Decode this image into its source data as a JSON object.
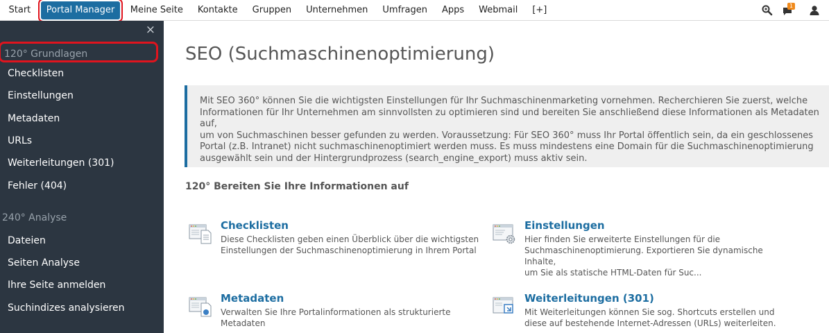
{
  "nav": {
    "items": [
      "Start",
      "Portal Manager",
      "Meine Seite",
      "Kontakte",
      "Gruppen",
      "Unternehmen",
      "Umfragen",
      "Apps",
      "Webmail",
      "[+]"
    ],
    "active_index": 1,
    "notification_count": "1"
  },
  "sidebar": {
    "close": "×",
    "groups": [
      {
        "title": "120° Grundlagen",
        "items": [
          "Checklisten",
          "Einstellungen",
          "Metadaten",
          "URLs",
          "Weiterleitungen (301)",
          "Fehler (404)"
        ]
      },
      {
        "title": "240° Analyse",
        "items": [
          "Dateien",
          "Seiten Analyse",
          "Ihre Seite anmelden",
          "Suchindizes analysieren"
        ]
      }
    ]
  },
  "main": {
    "title": "SEO (Suchmaschinenoptimierung)",
    "info_lines": [
      "Mit SEO 360° können Sie die wichtigsten Einstellungen für Ihr Suchmaschinenmarketing vornehmen. Recherchieren Sie zuerst, welche",
      "Informationen für Ihr Unternehmen am sinnvollsten zu optimieren sind und bereiten Sie anschließend diese Informationen als Metadaten auf,",
      "um von Suchmaschinen besser gefunden zu werden. Voraussetzung: Für SEO 360° muss Ihr Portal öffentlich sein, da ein geschlossenes",
      "Portal (z.B. Intranet) nicht suchmaschinenoptimiert werden muss. Es muss mindestens eine Domain für die Suchmaschinenoptimierung",
      "ausgewählt sein und der Hintergrundprozess (search_engine_export) muss aktiv sein."
    ],
    "section_title": "120° Bereiten Sie Ihre Informationen auf",
    "cards": [
      {
        "title": "Checklisten",
        "lines": [
          "Diese Checklisten geben einen Überblick über die wichtigsten",
          "Einstellungen der Suchmaschinenoptimierung in Ihrem Portal"
        ]
      },
      {
        "title": "Einstellungen",
        "lines": [
          "Hier finden Sie erweiterte Einstellungen für die",
          "Suchmaschinenoptimierung. Exportieren Sie dynamische Inhalte,",
          "um Sie als statische HTML-Daten für Suc..."
        ]
      },
      {
        "title": "Metadaten",
        "lines": [
          "Verwalten Sie Ihre Portalinformationen als strukturierte Metadaten"
        ]
      },
      {
        "title": "Weiterleitungen (301)",
        "lines": [
          "Mit Weiterleitungen können Sie sog. Shortcuts erstellen und",
          "diese auf bestehende Internet-Adressen (URLs) weiterleiten."
        ]
      }
    ]
  }
}
